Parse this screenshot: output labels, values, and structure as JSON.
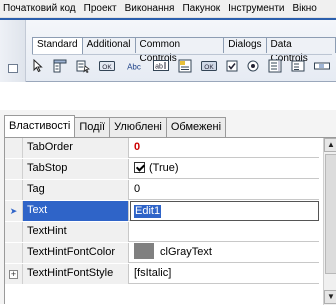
{
  "menu": {
    "items": [
      "Початковий код",
      "Проект",
      "Виконання",
      "Пакунок",
      "Інструменти",
      "Вікно"
    ]
  },
  "palette": {
    "tabs": [
      "Standard",
      "Additional",
      "Common Controls",
      "Dialogs",
      "Data Controls"
    ],
    "active_tab": "Standard",
    "tool_icons": [
      "pointer-icon",
      "mainmenu-icon",
      "popupmenu-icon",
      "button-icon",
      "label-icon",
      "edit-icon",
      "memo-icon",
      "togglebox-icon",
      "checkbox-icon",
      "radiobutton-icon",
      "listbox-icon",
      "combobox-icon",
      "scrollbar-icon"
    ],
    "tool_labels": {
      "button": "OK",
      "label": "Abc",
      "edit": "ab",
      "togglebox": "OK"
    }
  },
  "inspector": {
    "tabs": [
      "Властивості",
      "Події",
      "Улюблені",
      "Обмежені"
    ],
    "active_tab": "Властивості",
    "rows": [
      {
        "name": "TabOrder",
        "value": "0"
      },
      {
        "name": "TabStop",
        "value": "(True)"
      },
      {
        "name": "Tag",
        "value": "0"
      },
      {
        "name": "Text",
        "value": "Edit1"
      },
      {
        "name": "TextHint",
        "value": ""
      },
      {
        "name": "TextHintFontColor",
        "value": "clGrayText"
      },
      {
        "name": "TextHintFontStyle",
        "value": "[fsItalic]"
      }
    ],
    "selected_row": "Text",
    "colors": {
      "selection": "#2f64c8",
      "modified_value": "#cc0000",
      "swatch": "#808080"
    }
  }
}
